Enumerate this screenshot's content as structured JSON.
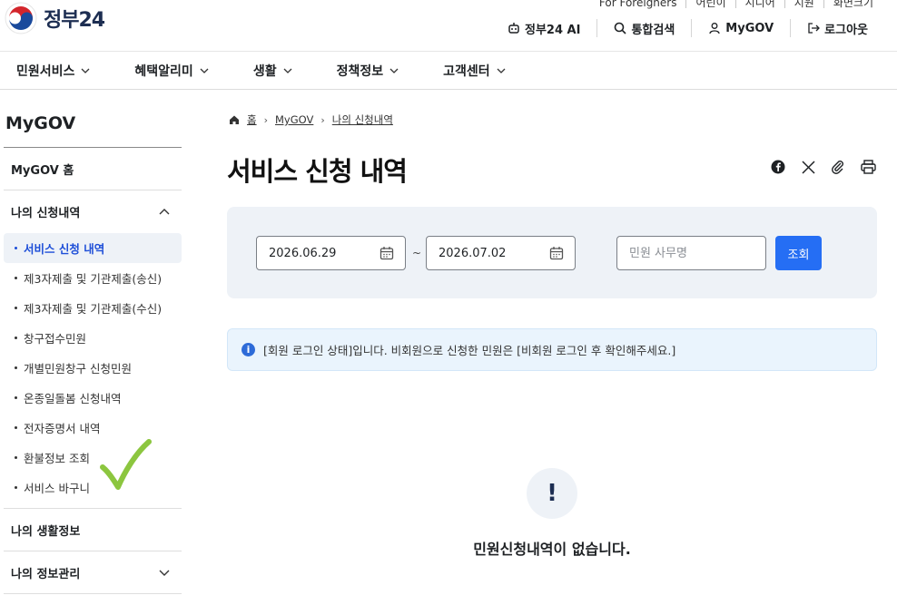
{
  "header": {
    "logo_text": "정부24",
    "util_links": [
      "For Foreigners",
      "어린이",
      "시니어",
      "지원",
      "화면크기"
    ],
    "actions": [
      {
        "label": "정부24 AI",
        "icon": "ai-robot-icon"
      },
      {
        "label": "통합검색",
        "icon": "search-icon"
      },
      {
        "label": "MyGOV",
        "icon": "user-icon"
      },
      {
        "label": "로그아웃",
        "icon": "logout-icon"
      }
    ]
  },
  "gnb": {
    "items": [
      "민원서비스",
      "혜택알리미",
      "생활",
      "정책정보",
      "고객센터"
    ]
  },
  "sidebar": {
    "title": "MyGOV",
    "sections": [
      {
        "label": "MyGOV 홈"
      },
      {
        "label": "나의 신청내역"
      }
    ],
    "sub_items": [
      "서비스 신청 내역",
      "제3자제출 및 기관제출(송신)",
      "제3자제출 및 기관제출(수신)",
      "창구접수민원",
      "개별민원창구 신청민원",
      "온종일돌봄 신청내역",
      "전자증명서 내역",
      "환불정보 조회",
      "서비스 바구니"
    ],
    "bottom_sections": [
      "나의 생활정보",
      "나의 정보관리"
    ]
  },
  "breadcrumb": {
    "home": "홈",
    "level1": "MyGOV",
    "level2": "나의 신청내역"
  },
  "page_title": "서비스 신청 내역",
  "search": {
    "start_date": "2026.06.29",
    "tilde": "~",
    "end_date": "2026.07.02",
    "keyword_placeholder": "민원 사무명",
    "button_label": "조회"
  },
  "notice": "[회원 로그인 상태]입니다. 비회원으로 신청한 민원은 [비회원 로그인 후 확인해주세요.]",
  "empty": {
    "icon": "!",
    "message": "민원신청내역이 없습니다."
  },
  "colors": {
    "primary": "#256ef4",
    "active_text": "#1d4ed8",
    "search_bg": "#eef2f7",
    "notice_bg": "#eaf4fd",
    "check_mark": "#8cc63f"
  }
}
